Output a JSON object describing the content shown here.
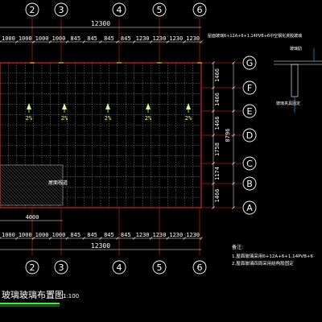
{
  "colors": {
    "background": "#000000",
    "axis_circle": "#ffffff",
    "axis_label": "#ffffff",
    "dimension_line": "#ffffff",
    "dimension_text": "#ffffff",
    "grid_line": "#c8c8c8",
    "outline_red": "#ff2a2a",
    "axis_marker": "#ffff00",
    "slope_arrow": "#d8ff7a",
    "note_text": "#ffffff",
    "title_underline": "#22ff22",
    "leader_cyan": "#00d8ff"
  },
  "column_axes": [
    "2",
    "3",
    "4",
    "5",
    "6"
  ],
  "row_axes": [
    "G",
    "F",
    "E",
    "D",
    "C",
    "B",
    "A"
  ],
  "top_dims": {
    "total": "12300",
    "segments": [
      "1000",
      "1000",
      "1000",
      "1000",
      "845",
      "845",
      "845",
      "845",
      "1230",
      "1230",
      "1230",
      "1230"
    ]
  },
  "bottom_dims": {
    "total": "12300",
    "segments": [
      "1000",
      "1000",
      "1000",
      "1000",
      "845",
      "845",
      "845",
      "845",
      "1230",
      "1230",
      "1230",
      "1230"
    ],
    "partial": "4000"
  },
  "right_dims": {
    "segments": [
      "1466",
      "1466",
      "1466",
      "1758",
      "1174",
      "1466"
    ],
    "total": "8796"
  },
  "slopes": [
    "2%",
    "2%",
    "2%",
    "2%",
    "2%"
  ],
  "area_label": "屋面栈道",
  "spec_note": "屋面玻璃6+12A+6+1.14PVB+6中空钢化夹胶玻璃",
  "detail": {
    "label_top": "玻璃肋",
    "label_side": "玻璃夹具固定"
  },
  "notes": {
    "title": "备注:",
    "items": [
      "1.屋面玻璃采用6+12A+6+1.14PVB+6",
      "2.屋面玻璃四周采用结构胶固定"
    ]
  },
  "drawing_title": {
    "main": "玻璃玻璃布置图",
    "scale": "1:100"
  }
}
